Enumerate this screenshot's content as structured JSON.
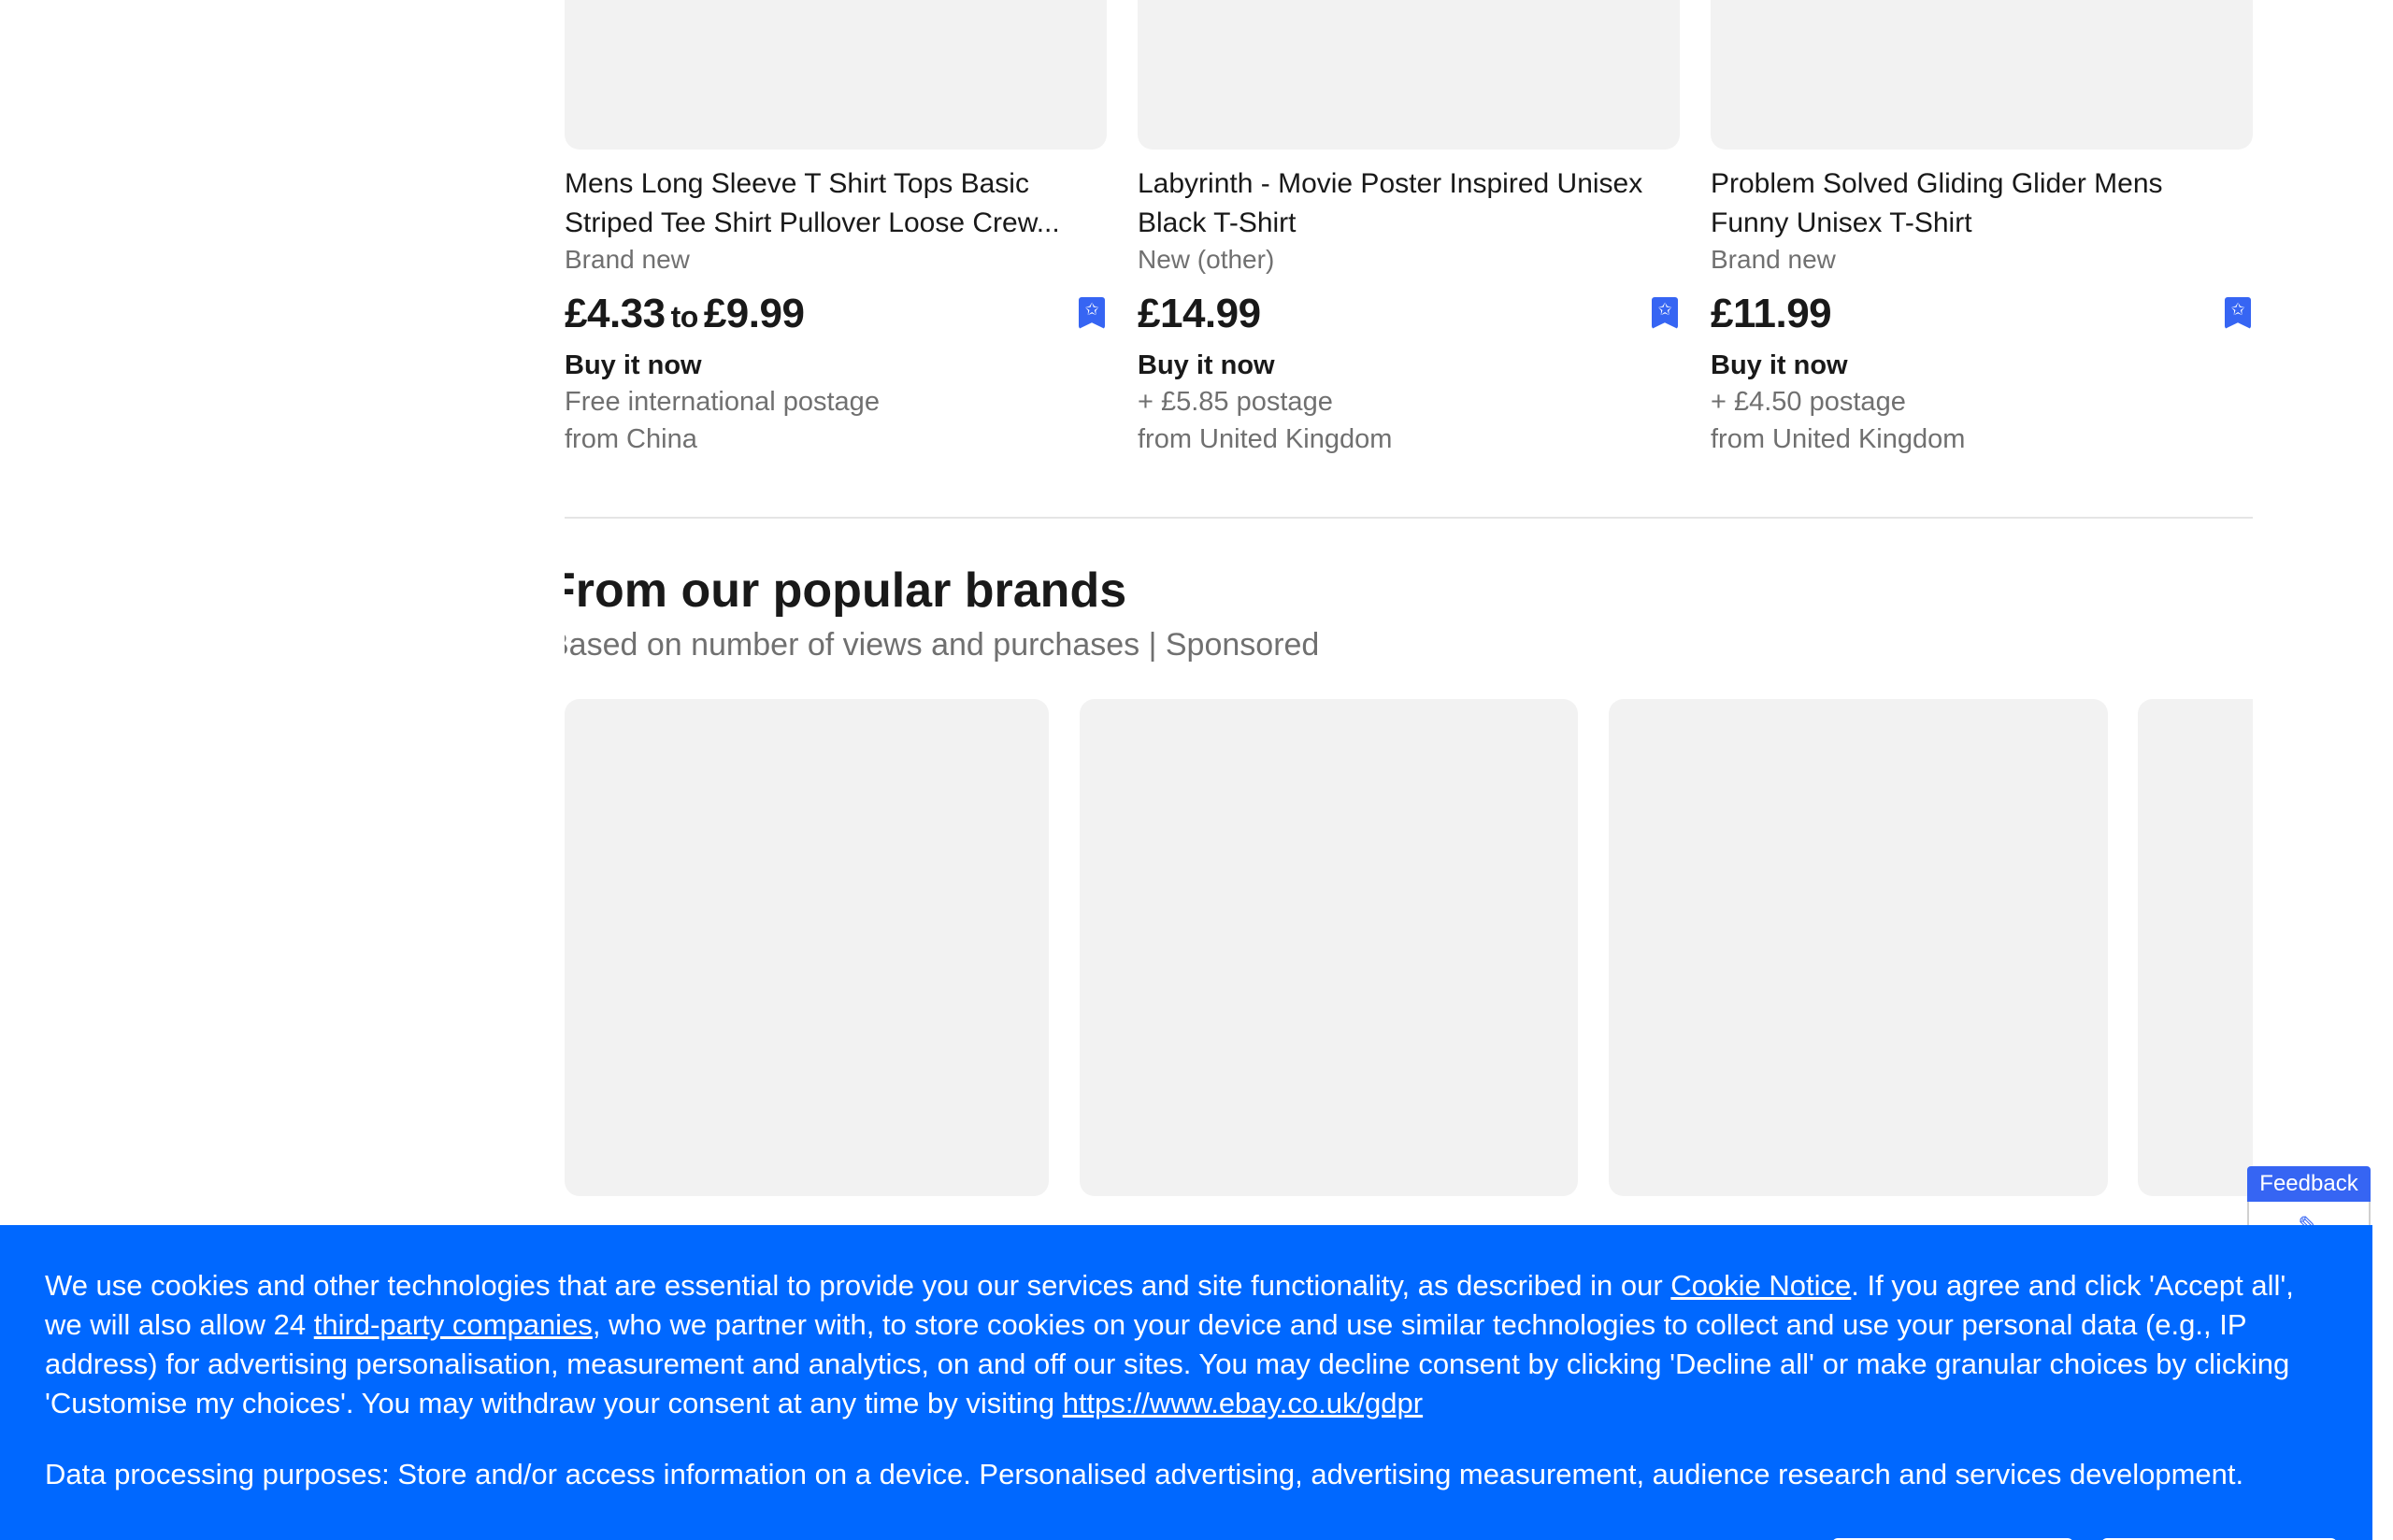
{
  "products": [
    {
      "title_line1": "Mens Long Sleeve T Shirt Tops Basic",
      "title_line2": "Striped Tee Shirt Pullover Loose Crew...",
      "condition": "Brand new",
      "price_low": "£4.33",
      "price_to": "to",
      "price_high": "£9.99",
      "buy_format": "Buy it now",
      "shipping": "Free international postage",
      "location": "from China"
    },
    {
      "title_line1": "Labyrinth - Movie Poster Inspired Unisex",
      "title_line2": "Black T-Shirt",
      "condition": "New (other)",
      "price": "£14.99",
      "buy_format": "Buy it now",
      "shipping": "+ £5.85 postage",
      "location": "from United Kingdom"
    },
    {
      "title_line1": "Problem Solved Gliding Glider Mens",
      "title_line2": "Funny Unisex T-Shirt",
      "condition": "Brand new",
      "price": "£11.99",
      "buy_format": "Buy it now",
      "shipping": "+ £4.50 postage",
      "location": "from United Kingdom"
    }
  ],
  "brands_section": {
    "title": "From our popular brands",
    "subtitle": "Based on number of views and purchases | Sponsored"
  },
  "feedback": {
    "label": "Feedback",
    "icon": "edit-icon"
  },
  "cookie_banner": {
    "text_part1": "We use cookies and other technologies that are essential to provide you our services and site functionality, as described in our ",
    "cookie_notice_link": "Cookie Notice",
    "text_part2": ". If you agree and click 'Accept all', we will also allow 24 ",
    "third_party_link": "third-party companies",
    "text_part3": ", who we partner with, to store cookies on your device and use similar technologies to collect and use your personal data (e.g., IP address) for advertising personalisation, measurement and analytics, on and off our sites. You may decline consent by clicking 'Decline all' or make granular choices by clicking 'Customise my choices'. You may withdraw your consent at any time by visiting ",
    "gdpr_link": "https://www.ebay.co.uk/gdpr",
    "purposes": "Data processing purposes: Store and/or access information on a device. Personalised advertising, advertising measurement, audience research and services development."
  },
  "colors": {
    "accent": "#3665f3",
    "cookie_banner_bg": "#0068ff",
    "placeholder_bg": "#f2f2f2",
    "muted_text": "#707070"
  }
}
